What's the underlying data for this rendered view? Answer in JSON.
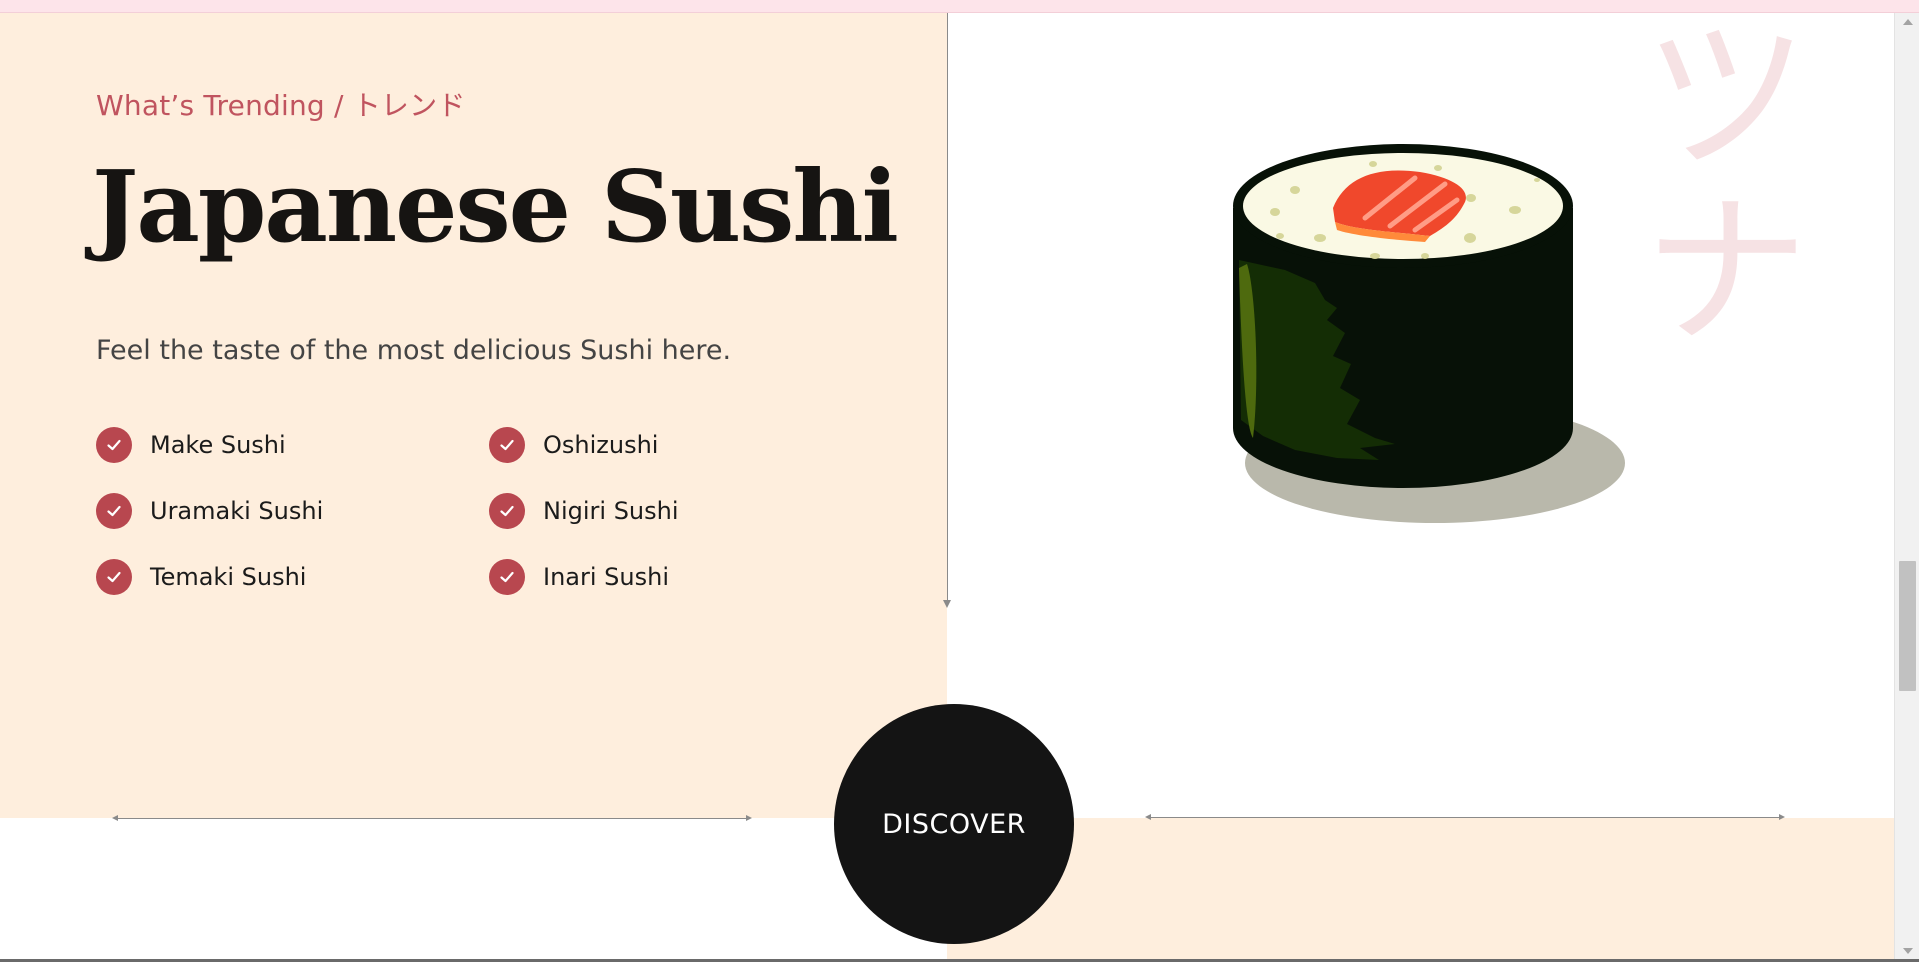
{
  "hero": {
    "eyebrow": "What’s Trending / トレンド",
    "title": "Japanese Sushi",
    "subtitle": "Feel the taste of the most delicious Sushi here.",
    "features": [
      "Make Sushi",
      "Oshizushi",
      "Uramaki Sushi",
      "Nigiri Sushi",
      "Temaki Sushi",
      "Inari Sushi"
    ],
    "cta_label": "DISCOVER"
  },
  "decor": {
    "kana_top": "ツ",
    "kana_bottom": "ナ",
    "image_icon": "sushi-roll-icon",
    "check_icon": "check-icon"
  },
  "colors": {
    "panel_bg": "#feeedd",
    "accent": "#b8474f",
    "eyebrow": "#c0545f",
    "cta_bg": "#141414",
    "top_strip": "#fde4ea"
  }
}
